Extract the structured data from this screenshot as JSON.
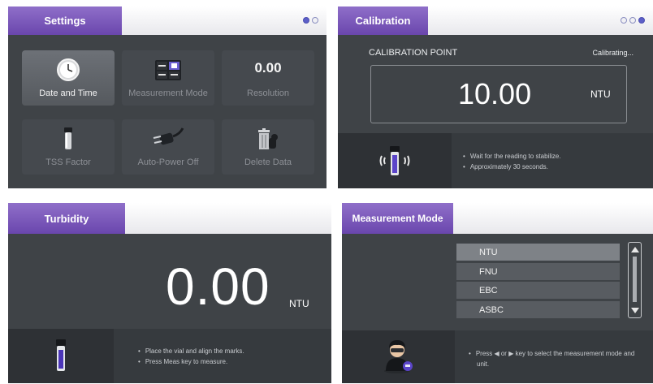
{
  "settings": {
    "title": "Settings",
    "resolution_display": "0.00",
    "tiles": [
      {
        "label": "Date and Time",
        "icon": "clock-icon",
        "selected": true
      },
      {
        "label": "Measurement Mode",
        "icon": "measurement-mode-icon",
        "selected": false
      },
      {
        "label": "Resolution",
        "icon": "resolution-icon",
        "selected": false
      },
      {
        "label": "TSS Factor",
        "icon": "vial-icon",
        "selected": false
      },
      {
        "label": "Auto-Power Off",
        "icon": "power-plug-icon",
        "selected": false
      },
      {
        "label": "Delete Data",
        "icon": "trash-icon",
        "selected": false
      }
    ]
  },
  "calibration": {
    "title": "Calibration",
    "point_label": "CALIBRATION POINT",
    "status": "Calibrating...",
    "value": "10.00",
    "unit": "NTU",
    "hints": [
      "Wait for the reading to stabilize.",
      "Approximately 30 seconds."
    ]
  },
  "turbidity": {
    "title": "Turbidity",
    "value": "0.00",
    "unit": "NTU",
    "hints": [
      "Place the vial and align the marks.",
      "Press Meas key to measure."
    ]
  },
  "measurement_mode": {
    "title": "Measurement Mode",
    "options": [
      "NTU",
      "FNU",
      "EBC",
      "ASBC"
    ],
    "selected": "NTU",
    "hints": [
      "Press ◀ or ▶ key to select the measurement mode and unit."
    ]
  },
  "colors": {
    "accent": "#7a56bb",
    "panel_bg": "#3f4347",
    "dot_active": "#5c5fc8"
  }
}
